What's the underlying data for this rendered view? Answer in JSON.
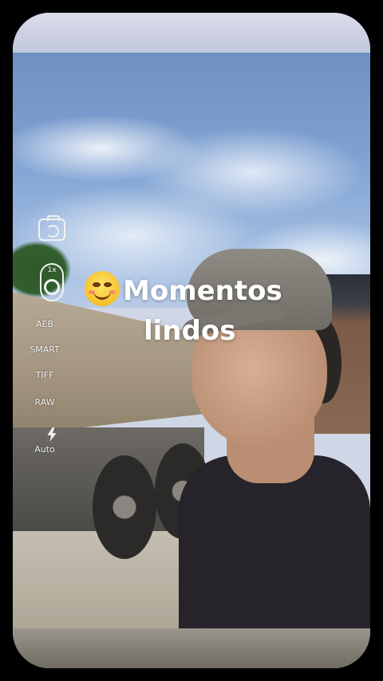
{
  "camera_controls": {
    "zoom": "1x",
    "aeb": "AEB",
    "smart": "SMART",
    "tiff": "TIFF",
    "raw": "RAW",
    "flash_mode": "Auto"
  },
  "icons": {
    "switch_camera": "switch-camera-icon",
    "shutter_zoom": "zoom-ring-icon",
    "flash": "lightning-bolt-icon",
    "emoji": "smiling-face-emoji"
  },
  "caption": {
    "line1": "Momentos",
    "line2": "lindos"
  }
}
